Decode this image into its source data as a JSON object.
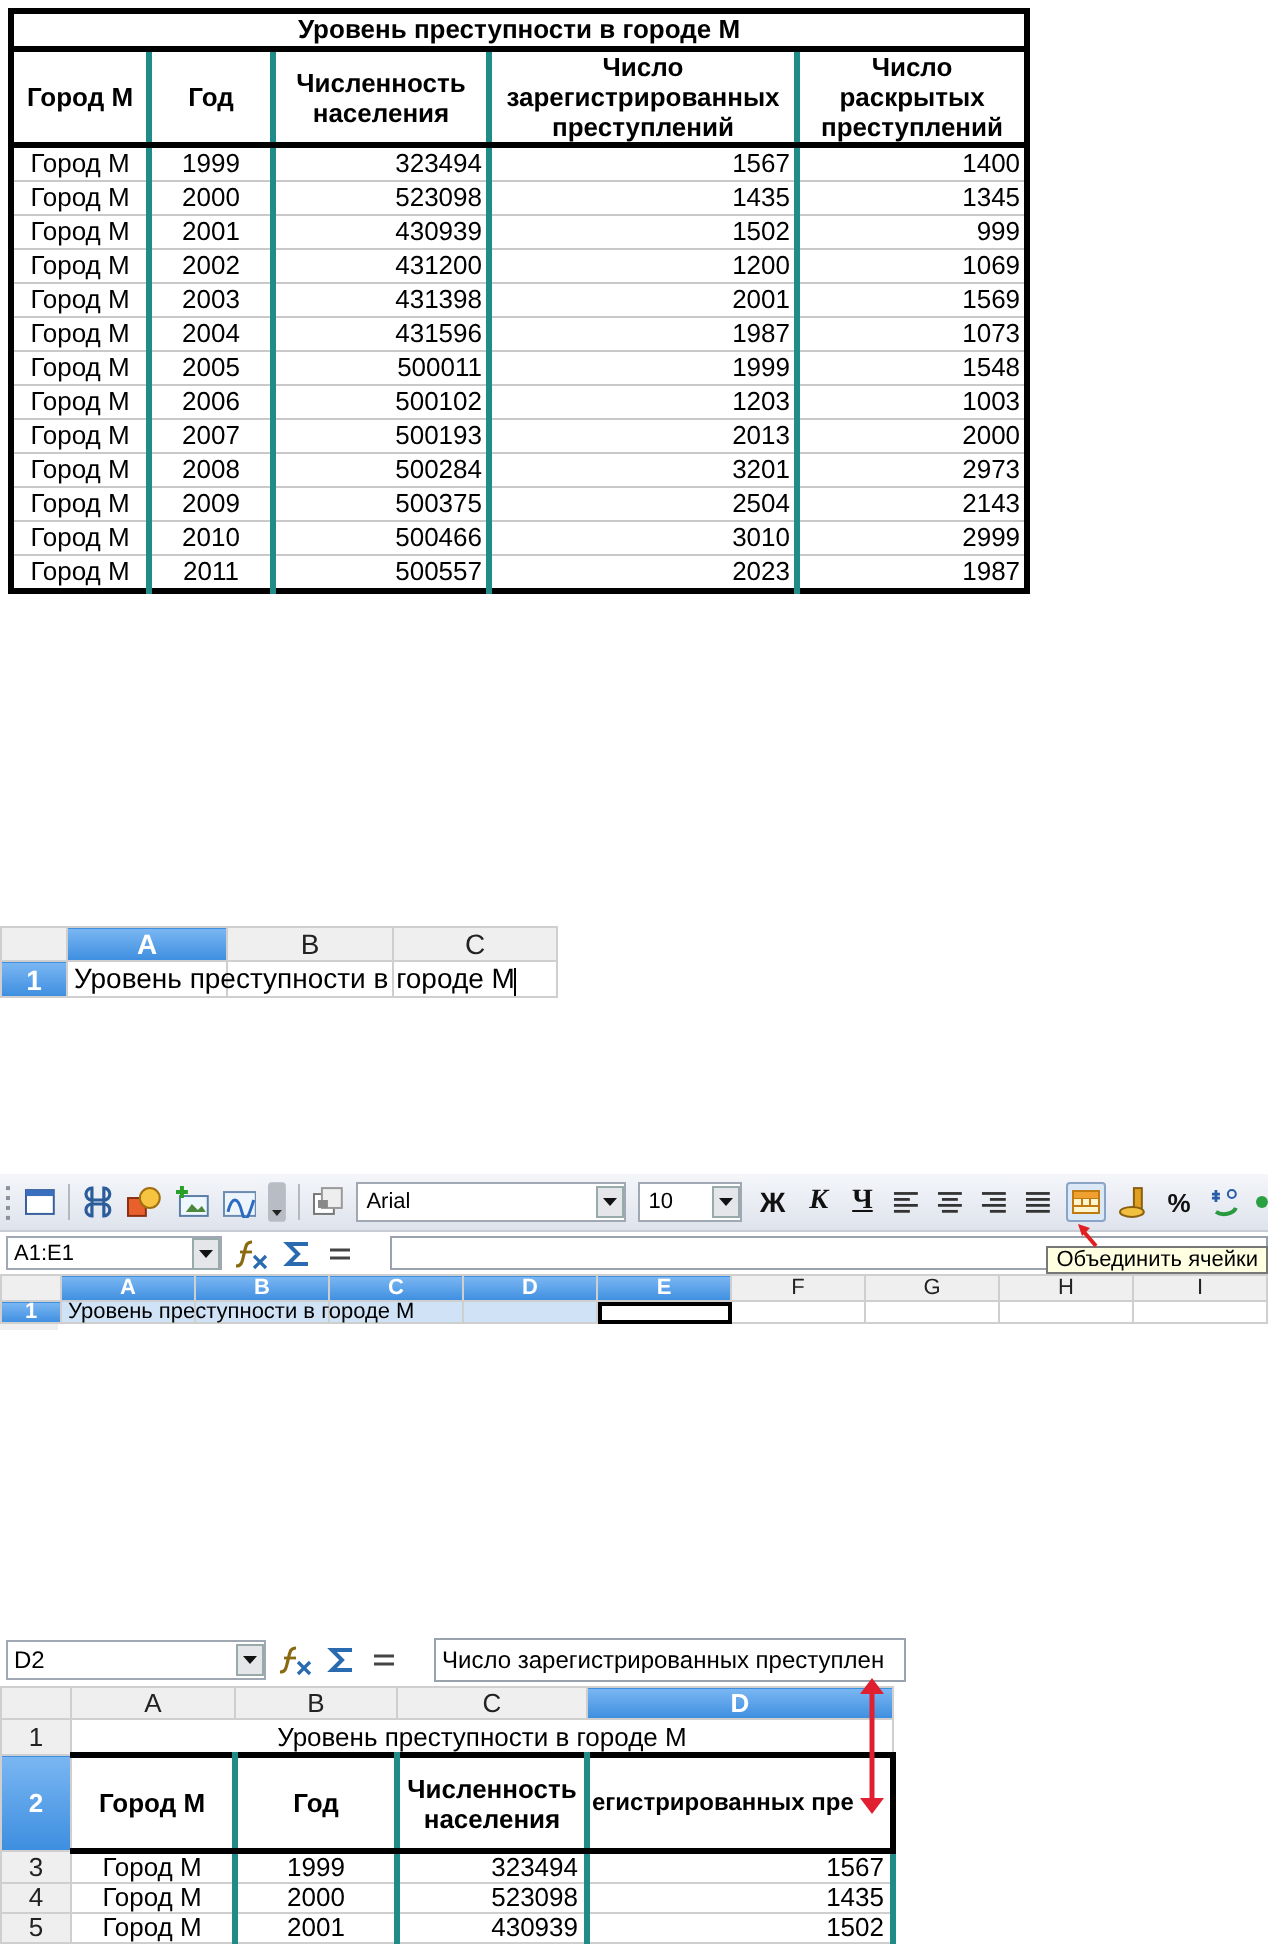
{
  "crime_table": {
    "title": "Уровень преступности в городе М",
    "columns": [
      "Город М",
      "Год",
      "Численность населения",
      "Число зарегистрированных преступлений",
      "Число раскрытых преступлений"
    ],
    "rows": [
      [
        "Город М",
        "1999",
        "323494",
        "1567",
        "1400"
      ],
      [
        "Город М",
        "2000",
        "523098",
        "1435",
        "1345"
      ],
      [
        "Город М",
        "2001",
        "430939",
        "1502",
        "999"
      ],
      [
        "Город М",
        "2002",
        "431200",
        "1200",
        "1069"
      ],
      [
        "Город М",
        "2003",
        "431398",
        "2001",
        "1569"
      ],
      [
        "Город М",
        "2004",
        "431596",
        "1987",
        "1073"
      ],
      [
        "Город М",
        "2005",
        "500011",
        "1999",
        "1548"
      ],
      [
        "Город М",
        "2006",
        "500102",
        "1203",
        "1003"
      ],
      [
        "Город М",
        "2007",
        "500193",
        "2013",
        "2000"
      ],
      [
        "Город М",
        "2008",
        "500284",
        "3201",
        "2973"
      ],
      [
        "Город М",
        "2009",
        "500375",
        "2504",
        "2143"
      ],
      [
        "Город М",
        "2010",
        "500466",
        "3010",
        "2999"
      ],
      [
        "Город М",
        "2011",
        "500557",
        "2023",
        "1987"
      ]
    ]
  },
  "cell_entry": {
    "editing": true,
    "columns": [
      {
        "label": "A",
        "selected": true
      },
      {
        "label": "B",
        "selected": false
      },
      {
        "label": "C",
        "selected": false
      }
    ],
    "rows": [
      {
        "label": "1",
        "selected": true,
        "cells": [
          "Уровень преступности в городе М"
        ]
      }
    ]
  },
  "merge_step": {
    "toolbar": {
      "font": "Arial",
      "font_size": "10",
      "bold": "Ж",
      "italic": "К",
      "underline": "Ч",
      "percent": "%"
    },
    "name_box": "A1:E1",
    "tooltip": "Объединить ячейки",
    "columns": [
      {
        "label": "A",
        "selected": true
      },
      {
        "label": "B",
        "selected": true
      },
      {
        "label": "C",
        "selected": true
      },
      {
        "label": "D",
        "selected": true
      },
      {
        "label": "E",
        "selected": true
      },
      {
        "label": "F",
        "selected": false
      },
      {
        "label": "G",
        "selected": false
      },
      {
        "label": "H",
        "selected": false
      },
      {
        "label": "I",
        "selected": false
      }
    ],
    "rows": [
      {
        "label": "1",
        "selected": true,
        "cells": [
          {
            "text": "Уровень преступности в городе М",
            "selected": true,
            "active": false
          },
          {
            "selected": true,
            "active": false
          },
          {
            "selected": true,
            "active": false
          },
          {
            "selected": true,
            "active": false
          },
          {
            "selected": false,
            "active": true
          }
        ]
      }
    ]
  },
  "wrap_step": {
    "name_box": "D2",
    "formula": "Число зарегистрированных преступлен",
    "columns": [
      {
        "label": "A",
        "selected": false
      },
      {
        "label": "B",
        "selected": false
      },
      {
        "label": "C",
        "selected": false
      },
      {
        "label": "D",
        "selected": true
      }
    ],
    "rows": [
      {
        "label": "1",
        "selected": false,
        "kind": "title",
        "cells": [
          {
            "text": "Уровень преступности в городе М",
            "colspan": 4
          }
        ]
      },
      {
        "label": "2",
        "selected": true,
        "kind": "header",
        "cells": [
          "Город М",
          "Год",
          "Численность населения",
          "егистрированных пре"
        ]
      },
      {
        "label": "3",
        "selected": false,
        "kind": "data",
        "cells": [
          "Город М",
          "1999",
          "323494",
          "1567"
        ]
      },
      {
        "label": "4",
        "selected": false,
        "kind": "data",
        "cells": [
          "Город М",
          "2000",
          "523098",
          "1435"
        ]
      },
      {
        "label": "5",
        "selected": false,
        "kind": "data",
        "cells": [
          "Город М",
          "2001",
          "430939",
          "1502"
        ]
      }
    ]
  }
}
